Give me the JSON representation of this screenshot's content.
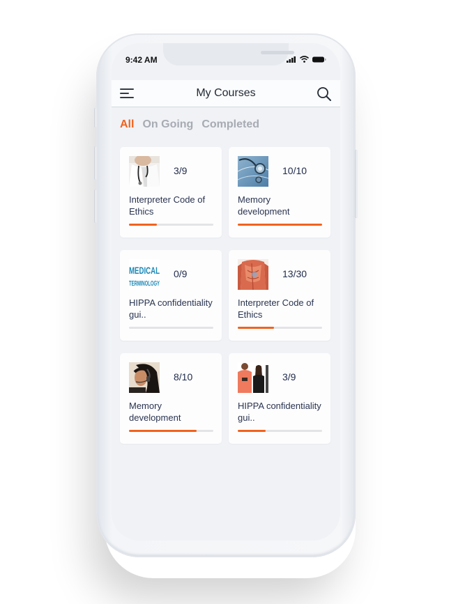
{
  "status_bar": {
    "time": "9:42 AM",
    "icons": [
      "signal-icon",
      "wifi-icon",
      "battery-icon"
    ]
  },
  "header": {
    "title": "My Courses",
    "menu_icon": "menu-icon",
    "search_icon": "search-icon"
  },
  "tabs": [
    {
      "label": "All",
      "active": true
    },
    {
      "label": "On Going",
      "active": false
    },
    {
      "label": "Completed",
      "active": false
    }
  ],
  "accent_color": "#f0621e",
  "courses": [
    {
      "title": "Interpreter Code of Ethics",
      "progress_label": "3/9",
      "progress": 0.333,
      "thumbnail": "doctor-stethoscope-image"
    },
    {
      "title": "Memory development",
      "progress_label": "10/10",
      "progress": 1.0,
      "thumbnail": "stethoscope-blue-image"
    },
    {
      "title": "HIPPA confidentiality gui..",
      "progress_label": "0/9",
      "progress": 0.0,
      "thumbnail": "medical-terminology-image",
      "thumb_text": [
        "MEDICAL",
        "TERMINOLOGY"
      ]
    },
    {
      "title": "Interpreter Code of Ethics",
      "progress_label": "13/30",
      "progress": 0.433,
      "thumbnail": "anatomy-image"
    },
    {
      "title": "Memory development",
      "progress_label": "8/10",
      "progress": 0.8,
      "thumbnail": "headset-woman-image"
    },
    {
      "title": "HIPPA confidentiality gui..",
      "progress_label": "3/9",
      "progress": 0.333,
      "thumbnail": "people-talking-image"
    }
  ]
}
